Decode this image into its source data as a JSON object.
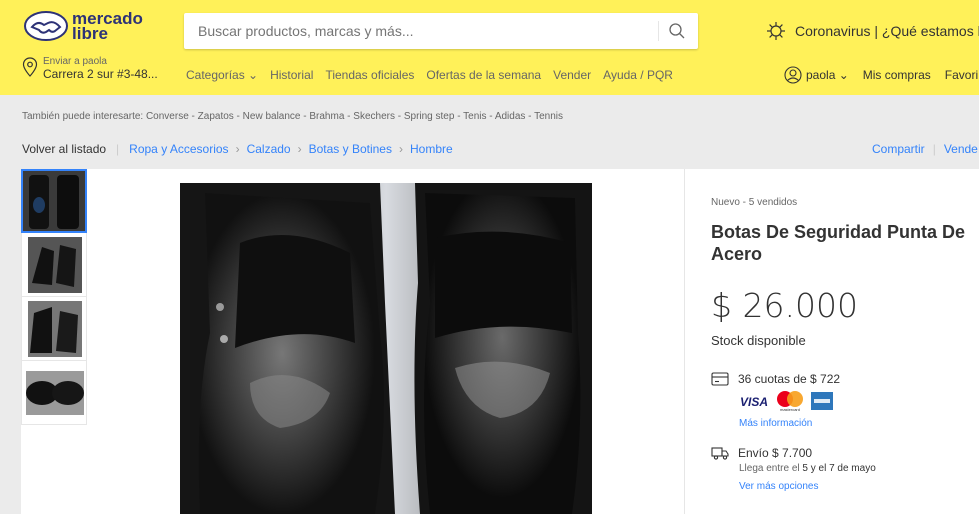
{
  "header": {
    "logo_line1": "mercado",
    "logo_line2": "libre",
    "search_placeholder": "Buscar productos, marcas y más...",
    "promo_text": "Coronavirus | ¿Qué estamos h",
    "location_small": "Enviar a paola",
    "location_address": "Carrera 2 sur #3-48...",
    "nav": [
      "Categorías ⌄",
      "Historial",
      "Tiendas oficiales",
      "Ofertas de la semana",
      "Vender",
      "Ayuda / PQR"
    ],
    "user_name": "paola ⌄",
    "my_purchases": "Mis compras",
    "favorites": "Favori"
  },
  "also_interested": "También puede interesarte: Converse - Zapatos - New balance - Brahma - Skechers - Spring step - Tenis - Adidas - Tennis",
  "breadcrumb": {
    "back": "Volver al listado",
    "items": [
      "Ropa y Accesorios",
      "Calzado",
      "Botas y Botines",
      "Hombre"
    ]
  },
  "share": {
    "share_label": "Compartir",
    "sell_label": "Vende"
  },
  "product": {
    "condition": "Nuevo  -  5 vendidos",
    "title": "Botas De Seguridad Punta De Acero",
    "price": "$ 26.000",
    "stock": "Stock disponible",
    "installments": "36 cuotas de $ 722",
    "more_info": "Más información",
    "shipping": "Envío $ 7.700",
    "arrive_prefix": "Llega entre el ",
    "arrive_date1": "5 y el 7 de mayo",
    "more_options": "Ver más opciones",
    "payment_logos": [
      "VISA",
      "mastercard",
      "amex"
    ]
  },
  "colors": {
    "header_bg": "#fff159",
    "link_blue": "#3483fa",
    "logo_blue": "#2d3277"
  }
}
